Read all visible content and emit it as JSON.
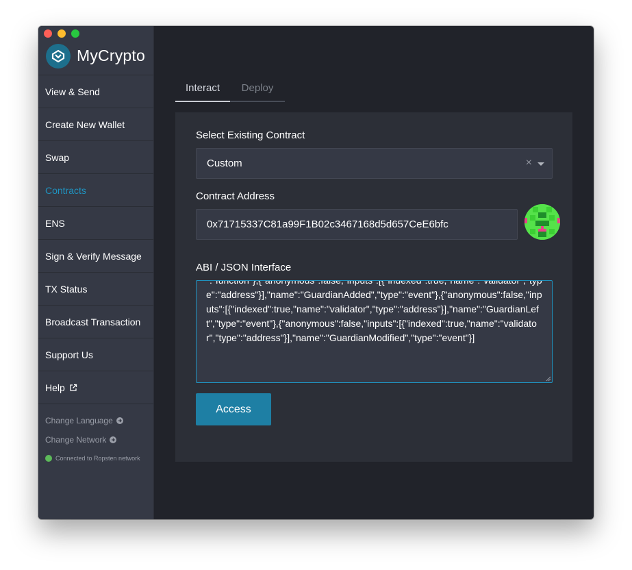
{
  "app": {
    "name": "MyCrypto"
  },
  "sidebar": {
    "items": [
      {
        "label": "View & Send"
      },
      {
        "label": "Create New Wallet"
      },
      {
        "label": "Swap"
      },
      {
        "label": "Contracts"
      },
      {
        "label": "ENS"
      },
      {
        "label": "Sign & Verify Message"
      },
      {
        "label": "TX Status"
      },
      {
        "label": "Broadcast Transaction"
      },
      {
        "label": "Support Us"
      },
      {
        "label": "Help"
      }
    ],
    "active_item": "Contracts",
    "change_language": "Change Language",
    "change_network": "Change Network",
    "network_status": "Connected to Ropsten network"
  },
  "tabs": [
    {
      "label": "Interact"
    },
    {
      "label": "Deploy"
    }
  ],
  "active_tab": "Interact",
  "form": {
    "select_label": "Select Existing Contract",
    "select_value": "Custom",
    "address_label": "Contract Address",
    "address_value": "0x71715337C81a99F1B02c3467168d5d657CeE6bfc",
    "abi_label": "ABI / JSON Interface",
    "abi_value": "\":\"function\"},{\"anonymous\":false,\"inputs\":[{\"indexed\":true,\"name\":\"validator\",\"type\":\"address\"}],\"name\":\"GuardianAdded\",\"type\":\"event\"},{\"anonymous\":false,\"inputs\":[{\"indexed\":true,\"name\":\"validator\",\"type\":\"address\"}],\"name\":\"GuardianLeft\",\"type\":\"event\"},{\"anonymous\":false,\"inputs\":[{\"indexed\":true,\"name\":\"validator\",\"type\":\"address\"}],\"name\":\"GuardianModified\",\"type\":\"event\"}]",
    "access_button": "Access"
  },
  "colors": {
    "accent": "#1f93c0",
    "button": "#1e7fa4",
    "sidebar_bg": "#353945",
    "main_bg": "#21232a",
    "panel_bg": "#2c2f37",
    "status_green": "#5dba5a"
  },
  "icons": {
    "logo": "mycrypto-logo-icon",
    "external_link": "external-link-icon",
    "arrow_circle": "arrow-right-circle-icon",
    "clear": "clear-x-icon",
    "dropdown": "chevron-down-icon",
    "identicon": "address-identicon"
  }
}
